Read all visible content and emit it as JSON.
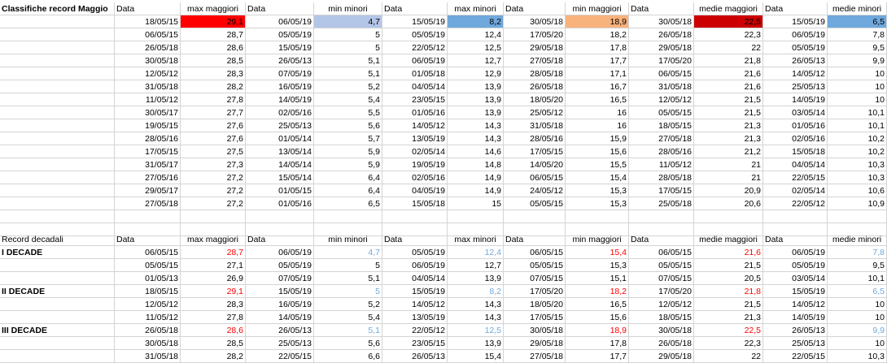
{
  "sheet": {
    "header_top": [
      "Classifiche record Maggio",
      "Data",
      "max maggiori",
      "Data",
      "min minori",
      "Data",
      "max minori",
      "Data",
      "min maggiori",
      "Data",
      "medie maggiori",
      "Data",
      "medie minori"
    ],
    "top_rows": [
      [
        "",
        "18/05/15",
        "29,1",
        "06/05/19",
        "4,7",
        "15/05/19",
        "8,2",
        "30/05/18",
        "18,9",
        "30/05/18",
        "22,5",
        "15/05/19",
        "6,5"
      ],
      [
        "",
        "06/05/15",
        "28,7",
        "05/05/19",
        "5",
        "05/05/19",
        "12,4",
        "17/05/20",
        "18,2",
        "26/05/18",
        "22,3",
        "06/05/19",
        "7,8"
      ],
      [
        "",
        "26/05/18",
        "28,6",
        "15/05/19",
        "5",
        "22/05/12",
        "12,5",
        "29/05/18",
        "17,8",
        "29/05/18",
        "22",
        "05/05/19",
        "9,5"
      ],
      [
        "",
        "30/05/18",
        "28,5",
        "26/05/13",
        "5,1",
        "06/05/19",
        "12,7",
        "27/05/18",
        "17,7",
        "17/05/20",
        "21,8",
        "26/05/13",
        "9,9"
      ],
      [
        "",
        "12/05/12",
        "28,3",
        "07/05/19",
        "5,1",
        "01/05/18",
        "12,9",
        "28/05/18",
        "17,1",
        "06/05/15",
        "21,6",
        "14/05/12",
        "10"
      ],
      [
        "",
        "31/05/18",
        "28,2",
        "16/05/19",
        "5,2",
        "04/05/14",
        "13,9",
        "26/05/18",
        "16,7",
        "31/05/18",
        "21,6",
        "25/05/13",
        "10"
      ],
      [
        "",
        "11/05/12",
        "27,8",
        "14/05/19",
        "5,4",
        "23/05/15",
        "13,9",
        "18/05/20",
        "16,5",
        "12/05/12",
        "21,5",
        "14/05/19",
        "10"
      ],
      [
        "",
        "30/05/17",
        "27,7",
        "02/05/16",
        "5,5",
        "01/05/16",
        "13,9",
        "25/05/12",
        "16",
        "05/05/15",
        "21,5",
        "03/05/14",
        "10,1"
      ],
      [
        "",
        "19/05/15",
        "27,6",
        "25/05/13",
        "5,6",
        "14/05/12",
        "14,3",
        "31/05/18",
        "16",
        "18/05/15",
        "21,3",
        "01/05/16",
        "10,1"
      ],
      [
        "",
        "28/05/16",
        "27,6",
        "01/05/14",
        "5,7",
        "13/05/19",
        "14,3",
        "28/05/16",
        "15,9",
        "27/05/18",
        "21,3",
        "02/05/16",
        "10,2"
      ],
      [
        "",
        "17/05/15",
        "27,5",
        "13/05/14",
        "5,9",
        "02/05/14",
        "14,6",
        "17/05/15",
        "15,6",
        "28/05/16",
        "21,2",
        "15/05/18",
        "10,2"
      ],
      [
        "",
        "31/05/17",
        "27,3",
        "14/05/14",
        "5,9",
        "19/05/19",
        "14,8",
        "14/05/20",
        "15,5",
        "11/05/12",
        "21",
        "04/05/14",
        "10,3"
      ],
      [
        "",
        "27/05/16",
        "27,2",
        "15/05/14",
        "6,4",
        "02/05/16",
        "14,9",
        "06/05/15",
        "15,4",
        "28/05/18",
        "21",
        "22/05/15",
        "10,3"
      ],
      [
        "",
        "29/05/17",
        "27,2",
        "01/05/15",
        "6,4",
        "04/05/19",
        "14,9",
        "24/05/12",
        "15,3",
        "17/05/15",
        "20,9",
        "02/05/14",
        "10,6"
      ],
      [
        "",
        "27/05/18",
        "27,2",
        "01/05/16",
        "6,5",
        "15/05/18",
        "15",
        "05/05/15",
        "15,3",
        "25/05/18",
        "20,6",
        "22/05/12",
        "10,9"
      ]
    ],
    "header_bottom": [
      "Record decadali",
      "Data",
      "max maggiori",
      "Data",
      "min minori",
      "Data",
      "max minori",
      "Data",
      "min maggiori",
      "Data",
      "medie maggiori",
      "Data",
      "medie minori"
    ],
    "decade_rows": [
      [
        "I DECADE",
        "06/05/15",
        "28,7",
        "06/05/19",
        "4,7",
        "05/05/19",
        "12,4",
        "06/05/15",
        "15,4",
        "06/05/15",
        "21,6",
        "06/05/19",
        "7,8"
      ],
      [
        "",
        "05/05/15",
        "27,1",
        "05/05/19",
        "5",
        "06/05/19",
        "12,7",
        "05/05/15",
        "15,3",
        "05/05/15",
        "21,5",
        "05/05/19",
        "9,5"
      ],
      [
        "",
        "01/05/13",
        "26,9",
        "07/05/19",
        "5,1",
        "04/05/14",
        "13,9",
        "07/05/15",
        "15,1",
        "07/05/15",
        "20,5",
        "03/05/14",
        "10,1"
      ],
      [
        "II DECADE",
        "18/05/15",
        "29,1",
        "15/05/19",
        "5",
        "15/05/19",
        "8,2",
        "17/05/20",
        "18,2",
        "17/05/20",
        "21,8",
        "15/05/19",
        "6,5"
      ],
      [
        "",
        "12/05/12",
        "28,3",
        "16/05/19",
        "5,2",
        "14/05/12",
        "14,3",
        "18/05/20",
        "16,5",
        "12/05/12",
        "21,5",
        "14/05/12",
        "10"
      ],
      [
        "",
        "11/05/12",
        "27,8",
        "14/05/19",
        "5,4",
        "13/05/19",
        "14,3",
        "17/05/15",
        "15,6",
        "18/05/15",
        "21,3",
        "14/05/19",
        "10"
      ],
      [
        "III DECADE",
        "26/05/18",
        "28,6",
        "26/05/13",
        "5,1",
        "22/05/12",
        "12,5",
        "30/05/18",
        "18,9",
        "30/05/18",
        "22,5",
        "26/05/13",
        "9,9"
      ],
      [
        "",
        "30/05/18",
        "28,5",
        "25/05/13",
        "5,6",
        "23/05/15",
        "13,9",
        "29/05/18",
        "17,8",
        "26/05/18",
        "22,3",
        "25/05/13",
        "10"
      ],
      [
        "",
        "31/05/18",
        "28,2",
        "22/05/15",
        "6,6",
        "26/05/13",
        "15,4",
        "27/05/18",
        "17,7",
        "29/05/18",
        "22",
        "22/05/15",
        "10,3"
      ]
    ]
  },
  "colors": {
    "max_maggiori_fill": "#ff0000",
    "min_minori_fill": "#b4c6e7",
    "max_minori_fill": "#6fa8dc",
    "min_maggiori_fill": "#f8b27c",
    "medie_maggiori_fill": "#cc0000",
    "medie_minori_fill": "#6fa8dc",
    "record_red_text": "#ff0000",
    "record_blue_text": "#6fa8dc"
  }
}
